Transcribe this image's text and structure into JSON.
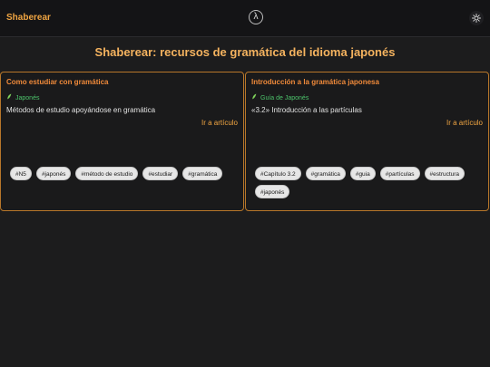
{
  "header": {
    "brand": "Shaberear",
    "logo_glyph": "λ",
    "logo_icon": "lambda-logo-icon",
    "theme_icon": "sun-icon"
  },
  "main": {
    "title": "Shaberear: recursos de gramática del idioma japonés"
  },
  "cards": [
    {
      "title": "Como estudiar con gramática",
      "category": "Japonés",
      "description": "Métodos de estudio apoyándose en gramática",
      "link": "Ir a artículo",
      "tags": [
        "#N5",
        "#japonés",
        "#método de estudio",
        "#estudiar",
        "#gramática"
      ]
    },
    {
      "title": "Introducción a la gramática japonesa",
      "category": "Guía de Japonés",
      "description": "«3.2» Introducción a las partículas",
      "link": "Ir a artículo",
      "tags": [
        "#Capítulo 3.2",
        "#gramática",
        "#guia",
        "#partículas",
        "#estructura",
        "#japonés"
      ]
    }
  ],
  "colors": {
    "background": "#1c1c1d",
    "accent": "#f0a542",
    "card_border": "#b8772a",
    "category_green": "#4cc26a"
  }
}
